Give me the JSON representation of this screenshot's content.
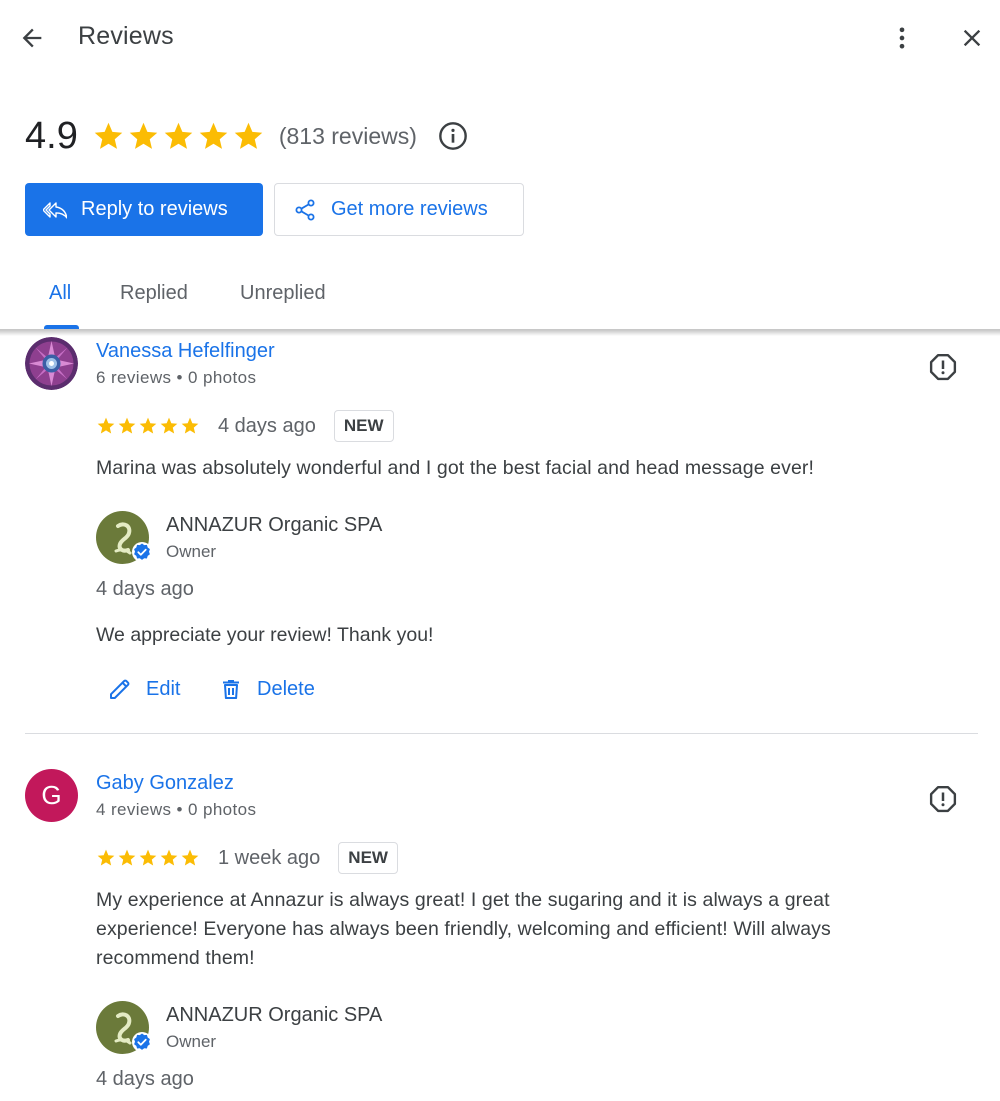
{
  "header": {
    "title": "Reviews",
    "back_icon": "arrow-back-icon",
    "more_icon": "more-vert-icon",
    "close_icon": "close-icon"
  },
  "summary": {
    "rating": "4.9",
    "stars": 5,
    "count_text": "(813 reviews)",
    "info_icon": "info-icon"
  },
  "actions": {
    "reply_label": "Reply to reviews",
    "get_more_label": "Get more reviews"
  },
  "tabs": [
    {
      "label": "All",
      "active": true
    },
    {
      "label": "Replied",
      "active": false
    },
    {
      "label": "Unreplied",
      "active": false
    }
  ],
  "reviews": [
    {
      "name": "Vanessa Hefelfinger",
      "meta": "6 reviews • 0 photos",
      "stars": 5,
      "date": "4 days ago",
      "badge": "NEW",
      "text": "Marina was absolutely wonderful and I got the best facial and head message ever!",
      "reply": {
        "owner_name": "ANNAZUR Organic SPA",
        "owner_role": "Owner",
        "date": "4 days ago",
        "text": "We appreciate your review! Thank you!",
        "edit_label": "Edit",
        "delete_label": "Delete"
      }
    },
    {
      "name": "Gaby Gonzalez",
      "avatar_letter": "G",
      "meta": "4 reviews • 0 photos",
      "stars": 5,
      "date": "1 week ago",
      "badge": "NEW",
      "text": "My experience at Annazur is always great! I get the sugaring and it is always a great experience! Everyone has always been friendly, welcoming and efficient! Will always recommend them!",
      "reply": {
        "owner_name": "ANNAZUR Organic SPA",
        "owner_role": "Owner",
        "date": "4 days ago"
      }
    }
  ],
  "colors": {
    "accent": "#1a73e8",
    "star": "#fbbc04",
    "avatar_g": "#c2185b",
    "owner_avatar": "#6b7a3a"
  }
}
